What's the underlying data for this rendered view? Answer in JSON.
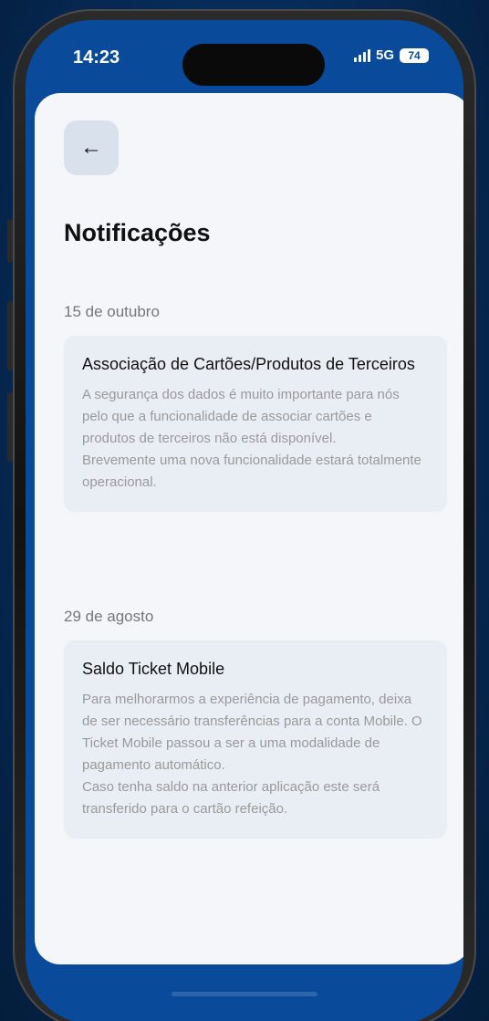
{
  "status_bar": {
    "time": "14:23",
    "network": "5G",
    "battery": "74"
  },
  "header": {
    "back_icon": "arrow-left-icon",
    "title": "Notificações"
  },
  "notifications": [
    {
      "date": "15 de outubro",
      "title": "Associação de Cartões/Produtos de Terceiros",
      "body": "A segurança dos dados é muito importante para nós pelo que a funcionalidade de associar cartões e produtos de terceiros não está disponível.\nBrevemente uma nova funcionalidade estará totalmente operacional."
    },
    {
      "date": "29 de agosto",
      "title": "Saldo Ticket Mobile",
      "body": "Para melhorarmos a experiência de pagamento, deixa de ser necessário transferências para a conta Mobile. O Ticket Mobile passou a ser a uma modalidade de pagamento automático.\nCaso tenha saldo na anterior aplicação este será transferido para o cartão refeição."
    }
  ],
  "colors": {
    "brand_blue": "#0a4a9a",
    "background": "#062a55",
    "card": "#e9eef4",
    "screen": "#f4f6f9"
  }
}
